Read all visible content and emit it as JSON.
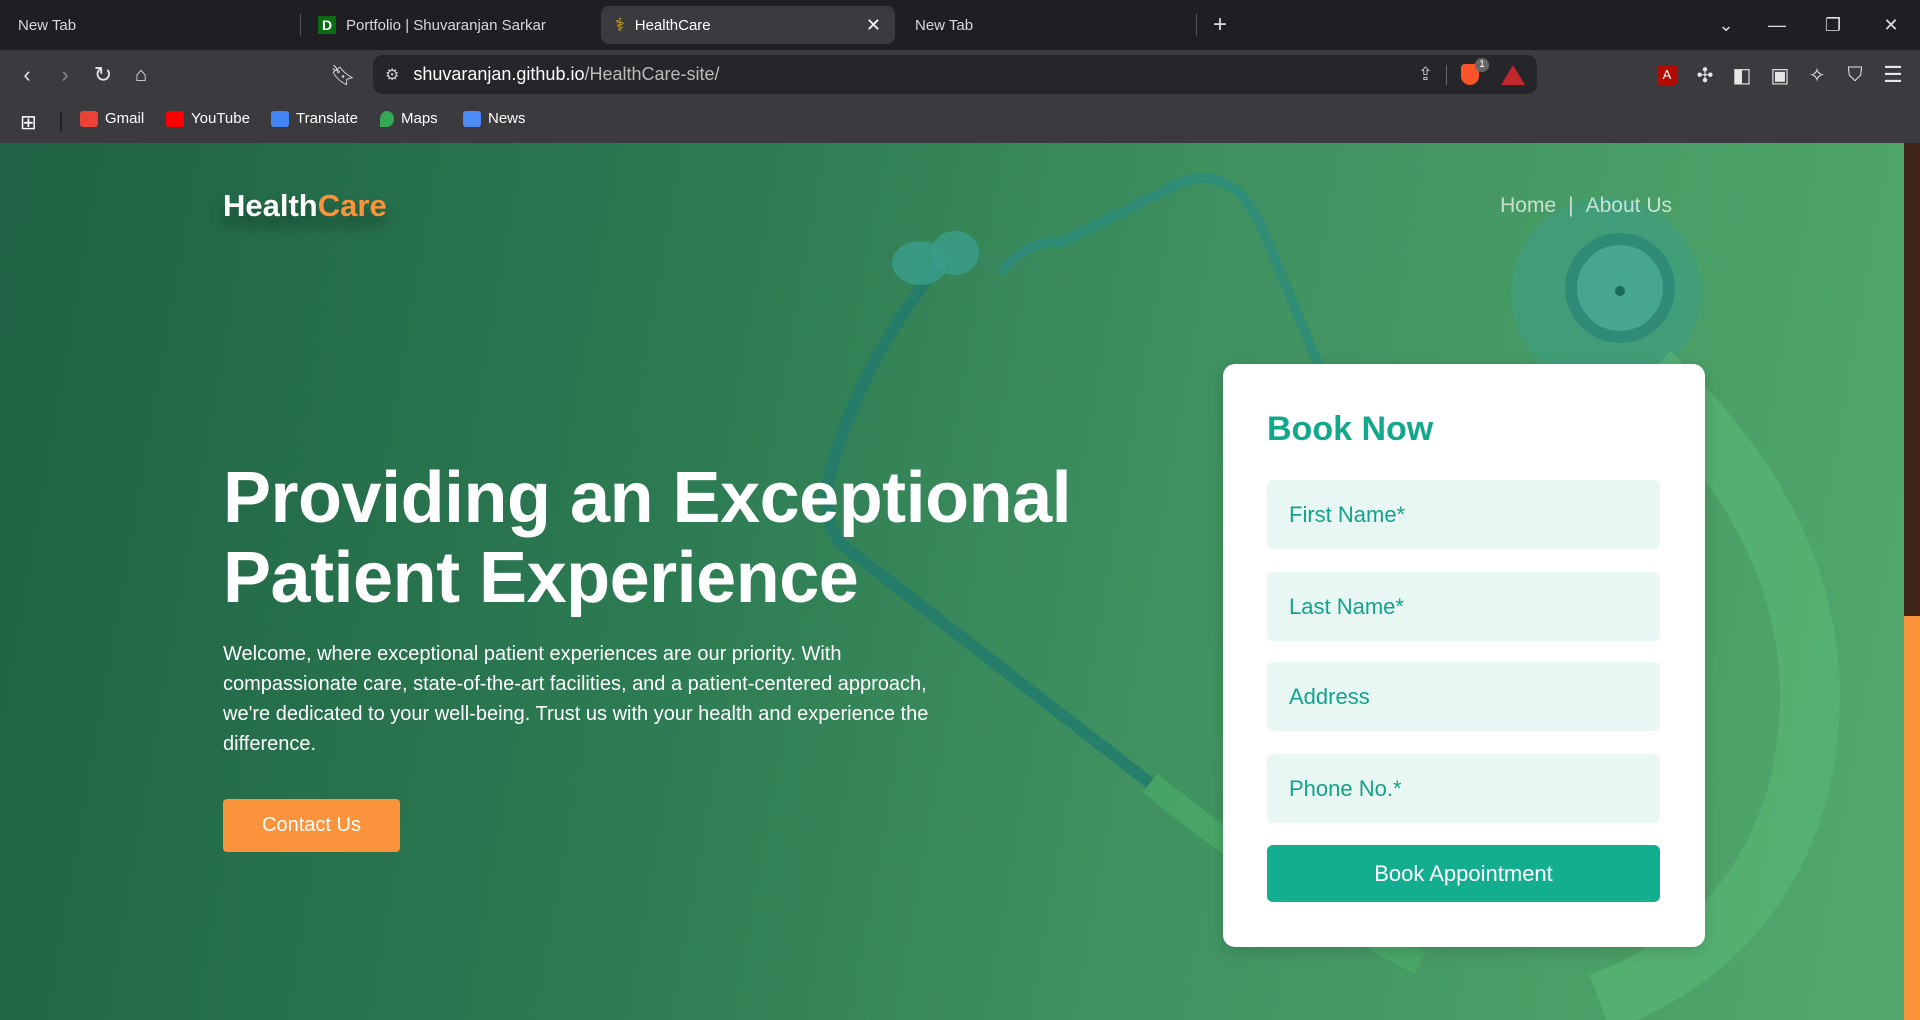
{
  "browser": {
    "tabs": [
      {
        "label": "New Tab",
        "active": false
      },
      {
        "label": "Portfolio | Shuvaranjan Sarkar",
        "favicon": "D",
        "active": false
      },
      {
        "label": "HealthCare",
        "active": true
      },
      {
        "label": "New Tab",
        "active": false
      }
    ],
    "url_host": "shuvaranjan.github.io",
    "url_path": "/HealthCare-site/",
    "brave_badge": "1",
    "bookmarks": [
      {
        "label": "Gmail",
        "color": "#ea4335"
      },
      {
        "label": "YouTube",
        "color": "#ff0000"
      },
      {
        "label": "Translate",
        "color": "#4285f4"
      },
      {
        "label": "Maps",
        "color": "#34a853"
      },
      {
        "label": "News",
        "color": "#4c8bf5"
      }
    ]
  },
  "site": {
    "logo_primary": "Health",
    "logo_accent": "Care",
    "nav": [
      "Home",
      "|",
      "About Us"
    ],
    "hero_title_line1": "Providing an Exceptional",
    "hero_title_line2": "Patient Experience",
    "hero_text": "Welcome, where exceptional patient experiences are our priority. With compassionate care, state-of-the-art facilities, and a patient-centered approach, we're dedicated to your well-being. Trust us with your health and experience the difference.",
    "contact_label": "Contact Us",
    "form": {
      "title": "Book Now",
      "fields": [
        "First Name*",
        "Last Name*",
        "Address",
        "Phone No.*"
      ],
      "submit": "Book Appointment"
    },
    "colors": {
      "accent": "#fb923c",
      "teal": "#13a88c",
      "bg_green": "#2c7a52"
    }
  }
}
